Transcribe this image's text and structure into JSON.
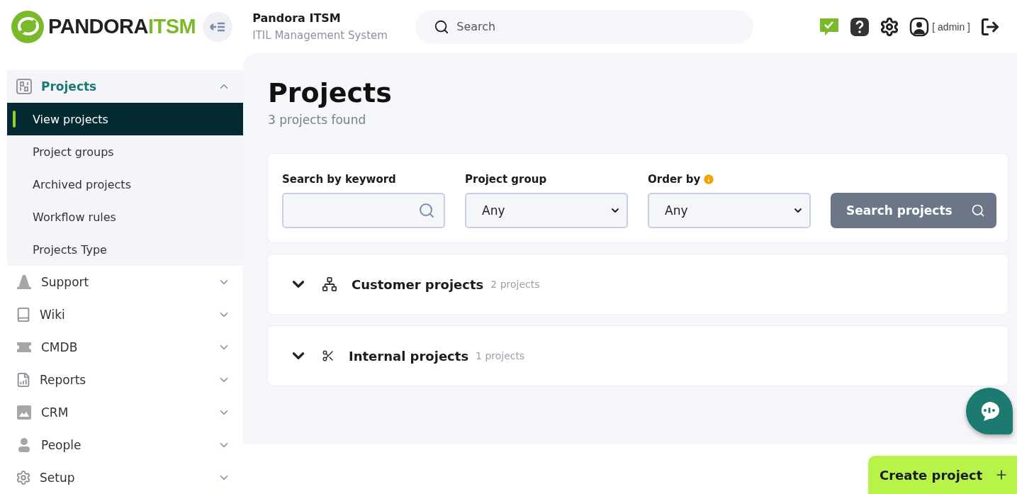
{
  "header": {
    "logo": {
      "brand": "PANDORA",
      "accent": "ITSM"
    },
    "app_title": "Pandora ITSM",
    "app_subtitle": "ITIL Management System",
    "search": {
      "placeholder": "Search"
    },
    "user": "[ admin ]"
  },
  "sidebar": {
    "items": [
      {
        "label": "Projects",
        "expanded": true,
        "children": [
          {
            "label": "View projects",
            "selected": true
          },
          {
            "label": "Project groups",
            "selected": false
          },
          {
            "label": "Archived projects",
            "selected": false
          },
          {
            "label": "Workflow rules",
            "selected": false
          },
          {
            "label": "Projects Type",
            "selected": false
          }
        ]
      },
      {
        "label": "Support",
        "expanded": false
      },
      {
        "label": "Wiki",
        "expanded": false
      },
      {
        "label": "CMDB",
        "expanded": false
      },
      {
        "label": "Reports",
        "expanded": false
      },
      {
        "label": "CRM",
        "expanded": false
      },
      {
        "label": "People",
        "expanded": false
      },
      {
        "label": "Setup",
        "expanded": false
      }
    ]
  },
  "page": {
    "title": "Projects",
    "subtitle": "3 projects found",
    "filters": {
      "keyword": {
        "label": "Search by keyword"
      },
      "project_group": {
        "label": "Project group",
        "value": "Any"
      },
      "order_by": {
        "label": "Order by",
        "value": "Any"
      },
      "search_button": "Search projects"
    },
    "groups": [
      {
        "name": "Customer projects",
        "count": "2 projects",
        "expanded": false
      },
      {
        "name": "Internal projects",
        "count": "1 projects",
        "expanded": false
      }
    ]
  },
  "create_button": "Create project"
}
